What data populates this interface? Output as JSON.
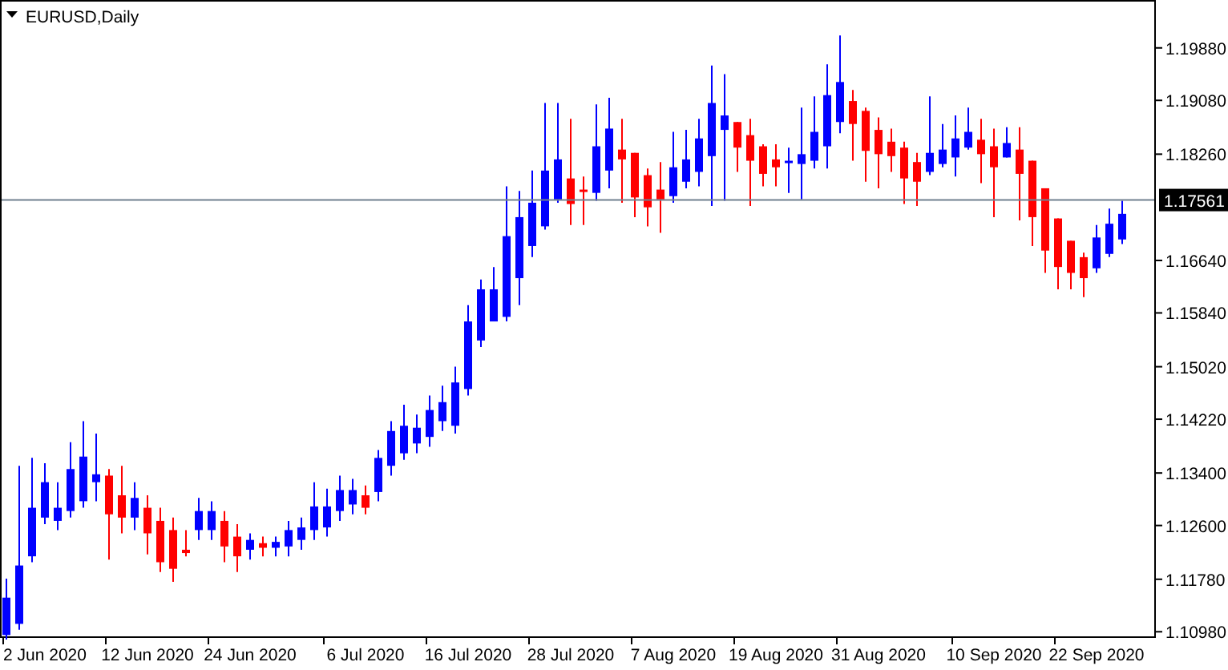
{
  "chart": {
    "chart_data": {
      "type": "candlestick",
      "title": "EURUSD,Daily",
      "categories": [
        null,
        null,
        null,
        "2 Jun 2020",
        null,
        null,
        null,
        null,
        null,
        null,
        null,
        "12 Jun 2020",
        null,
        null,
        null,
        null,
        null,
        null,
        null,
        "24 Jun 2020",
        null,
        null,
        null,
        null,
        null,
        null,
        null,
        null,
        "6 Jul 2020",
        null,
        null,
        null,
        null,
        null,
        null,
        null,
        "16 Jul 2020",
        null,
        null,
        null,
        null,
        null,
        null,
        null,
        "28 Jul 2020",
        null,
        null,
        null,
        null,
        null,
        null,
        null,
        "7 Aug 2020",
        null,
        null,
        null,
        null,
        null,
        null,
        null,
        "19 Aug 2020",
        null,
        null,
        null,
        null,
        null,
        null,
        null,
        "31 Aug 2020",
        null,
        null,
        null,
        null,
        null,
        null,
        null,
        null,
        "10 Sep 2020",
        null,
        null,
        null,
        null,
        null,
        null,
        null,
        "22 Sep 2020",
        null,
        null,
        null,
        null
      ],
      "ohlc": [
        [
          1.1093,
          1.1179,
          1.1086,
          1.115
        ],
        [
          1.111,
          1.1351,
          1.1101,
          1.1199
        ],
        [
          1.1213,
          1.1363,
          1.1204,
          1.1287
        ],
        [
          1.1272,
          1.1355,
          1.1262,
          1.1326
        ],
        [
          1.1267,
          1.1326,
          1.1253,
          1.1287
        ],
        [
          1.1282,
          1.1387,
          1.1272,
          1.1346
        ],
        [
          1.1297,
          1.1419,
          1.1287,
          1.1365
        ],
        [
          1.1326,
          1.14,
          1.1297,
          1.1338
        ],
        [
          1.1336,
          1.1346,
          1.1208,
          1.1277
        ],
        [
          1.1306,
          1.1351,
          1.1248,
          1.1272
        ],
        [
          1.1272,
          1.1326,
          1.1253,
          1.1302
        ],
        [
          1.1287,
          1.1306,
          1.1216,
          1.1248
        ],
        [
          1.1267,
          1.1287,
          1.1189,
          1.1204
        ],
        [
          1.1253,
          1.1272,
          1.1174,
          1.1194
        ],
        [
          1.1223,
          1.1253,
          1.1213,
          1.1218
        ],
        [
          1.1253,
          1.1302,
          1.1238,
          1.1282
        ],
        [
          1.1253,
          1.1297,
          1.1238,
          1.1282
        ],
        [
          1.1267,
          1.1282,
          1.1204,
          1.1228
        ],
        [
          1.1243,
          1.1262,
          1.1189,
          1.1213
        ],
        [
          1.1223,
          1.1248,
          1.1208,
          1.1238
        ],
        [
          1.1233,
          1.1243,
          1.1213,
          1.1226
        ],
        [
          1.1226,
          1.1243,
          1.1213,
          1.1235
        ],
        [
          1.1228,
          1.1267,
          1.1213,
          1.1253
        ],
        [
          1.1238,
          1.1272,
          1.1223,
          1.1257
        ],
        [
          1.1253,
          1.1326,
          1.1238,
          1.1289
        ],
        [
          1.1257,
          1.1316,
          1.1243,
          1.1289
        ],
        [
          1.1282,
          1.1336,
          1.1267,
          1.1314
        ],
        [
          1.1292,
          1.1331,
          1.1277,
          1.1314
        ],
        [
          1.1306,
          1.1321,
          1.1277,
          1.1287
        ],
        [
          1.1311,
          1.1375,
          1.1297,
          1.1363
        ],
        [
          1.1351,
          1.1419,
          1.1336,
          1.1404
        ],
        [
          1.137,
          1.1444,
          1.136,
          1.1412
        ],
        [
          1.1385,
          1.1429,
          1.137,
          1.1409
        ],
        [
          1.1395,
          1.1458,
          1.138,
          1.1436
        ],
        [
          1.1419,
          1.1473,
          1.1404,
          1.1448
        ],
        [
          1.1412,
          1.1502,
          1.14,
          1.1478
        ],
        [
          1.1468,
          1.1596,
          1.1458,
          1.1571
        ],
        [
          1.1542,
          1.1635,
          1.1532,
          1.162
        ],
        [
          1.1571,
          1.1654,
          1.1571,
          1.162
        ],
        [
          1.1578,
          1.1777,
          1.1571,
          1.1701
        ],
        [
          1.1637,
          1.177,
          1.1596,
          1.173
        ],
        [
          1.1686,
          1.1801,
          1.1669,
          1.1752
        ],
        [
          1.1716,
          1.1904,
          1.1711,
          1.1801
        ],
        [
          1.1757,
          1.1904,
          1.1752,
          1.1818
        ],
        [
          1.1789,
          1.188,
          1.1718,
          1.175
        ],
        [
          1.1772,
          1.1792,
          1.1718,
          1.177
        ],
        [
          1.1767,
          1.1902,
          1.1755,
          1.1838
        ],
        [
          1.1801,
          1.1912,
          1.1774,
          1.1865
        ],
        [
          1.1833,
          1.188,
          1.1752,
          1.1818
        ],
        [
          1.1828,
          1.1828,
          1.173,
          1.176
        ],
        [
          1.1794,
          1.1804,
          1.1716,
          1.1745
        ],
        [
          1.1772,
          1.1814,
          1.1706,
          1.1757
        ],
        [
          1.1762,
          1.186,
          1.1752,
          1.1806
        ],
        [
          1.1784,
          1.1863,
          1.1774,
          1.1818
        ],
        [
          1.1799,
          1.188,
          1.1777,
          1.185
        ],
        [
          1.1823,
          1.1961,
          1.1747,
          1.1904
        ],
        [
          1.1863,
          1.1948,
          1.1755,
          1.1885
        ],
        [
          1.1875,
          1.1875,
          1.1799,
          1.1836
        ],
        [
          1.1855,
          1.188,
          1.1747,
          1.1816
        ],
        [
          1.1838,
          1.1841,
          1.1777,
          1.1796
        ],
        [
          1.1818,
          1.1841,
          1.1777,
          1.1806
        ],
        [
          1.1814,
          1.1836,
          1.1767,
          1.1816
        ],
        [
          1.1811,
          1.1897,
          1.1757,
          1.1826
        ],
        [
          1.1816,
          1.1914,
          1.1804,
          1.186
        ],
        [
          1.1838,
          1.1963,
          1.1804,
          1.1916
        ],
        [
          1.1875,
          1.2007,
          1.1858,
          1.1936
        ],
        [
          1.1907,
          1.1924,
          1.1816,
          1.1872
        ],
        [
          1.1892,
          1.1897,
          1.1784,
          1.1831
        ],
        [
          1.1863,
          1.1882,
          1.1774,
          1.1826
        ],
        [
          1.1845,
          1.1865,
          1.1799,
          1.1823
        ],
        [
          1.1836,
          1.1845,
          1.175,
          1.1789
        ],
        [
          1.1814,
          1.1828,
          1.1747,
          1.1784
        ],
        [
          1.1799,
          1.1914,
          1.1794,
          1.1828
        ],
        [
          1.1811,
          1.1872,
          1.1806,
          1.1833
        ],
        [
          1.1821,
          1.1885,
          1.1792,
          1.185
        ],
        [
          1.1836,
          1.1897,
          1.1833,
          1.186
        ],
        [
          1.1848,
          1.188,
          1.1782,
          1.1826
        ],
        [
          1.1838,
          1.1865,
          1.173,
          1.1806
        ],
        [
          1.1821,
          1.1867,
          1.1821,
          1.1843
        ],
        [
          1.1833,
          1.1867,
          1.1725,
          1.1796
        ],
        [
          1.1816,
          1.1816,
          1.1686,
          1.173
        ],
        [
          1.1774,
          1.1774,
          1.1645,
          1.1679
        ],
        [
          1.1728,
          1.1728,
          1.162,
          1.1654
        ],
        [
          1.1694,
          1.1694,
          1.162,
          1.1645
        ],
        [
          1.1669,
          1.1676,
          1.1608,
          1.1637
        ],
        [
          1.1652,
          1.1718,
          1.1645,
          1.1699
        ],
        [
          1.1674,
          1.1743,
          1.1669,
          1.172
        ],
        [
          1.1696,
          1.1755,
          1.1689,
          1.1735
        ],
        null,
        null
      ],
      "ylim": [
        1.1091,
        1.2061
      ],
      "yticks": [
        {
          "value": 1.1988,
          "label": "1.19880"
        },
        {
          "value": 1.1908,
          "label": "1.19080"
        },
        {
          "value": 1.1826,
          "label": "1.18260"
        },
        {
          "value": 1.1664,
          "label": "1.16640"
        },
        {
          "value": 1.1584,
          "label": "1.15840"
        },
        {
          "value": 1.1502,
          "label": "1.15020"
        },
        {
          "value": 1.1422,
          "label": "1.14220"
        },
        {
          "value": 1.134,
          "label": "1.13400"
        },
        {
          "value": 1.126,
          "label": "1.12600"
        },
        {
          "value": 1.1178,
          "label": "1.11780"
        },
        {
          "value": 1.1098,
          "label": "1.10980"
        }
      ],
      "ref_lines": [
        {
          "axis": "y",
          "value": 1.17561,
          "label": "1.17561"
        }
      ]
    }
  }
}
